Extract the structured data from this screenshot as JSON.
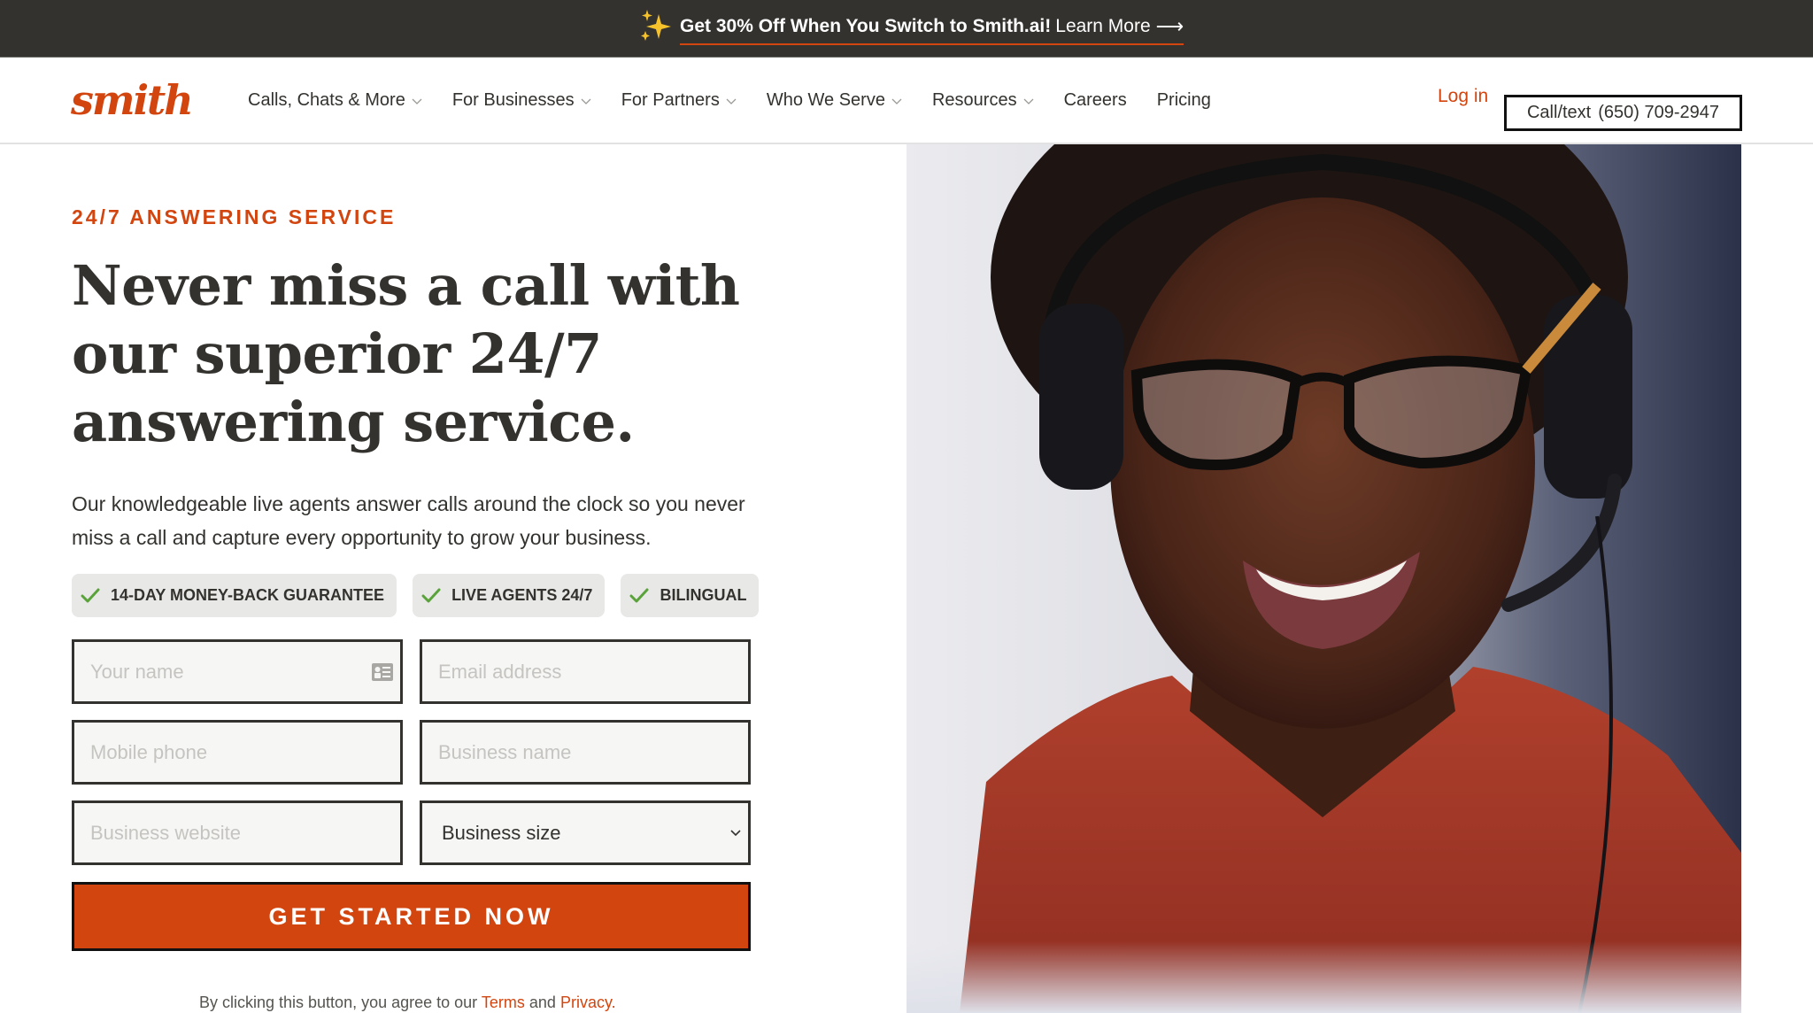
{
  "banner": {
    "icon": "sparkles-icon",
    "headline": "Get 30% Off When You Switch to Smith.ai!",
    "link_label": "Learn More",
    "arrow": "⟶"
  },
  "header": {
    "logo_text": "smith",
    "nav": [
      {
        "label": "Calls, Chats & More",
        "has_dropdown": true
      },
      {
        "label": "For Businesses",
        "has_dropdown": true
      },
      {
        "label": "For Partners",
        "has_dropdown": true
      },
      {
        "label": "Who We Serve",
        "has_dropdown": true
      },
      {
        "label": "Resources",
        "has_dropdown": true
      },
      {
        "label": "Careers",
        "has_dropdown": false
      },
      {
        "label": "Pricing",
        "has_dropdown": false
      }
    ],
    "login_label": "Log in",
    "call_label": "Call/text",
    "call_number": "(650) 709-2947"
  },
  "hero": {
    "eyebrow": "24/7 ANSWERING SERVICE",
    "headline_lines": [
      "Never miss a call with",
      "our superior 24/7",
      "answering service."
    ],
    "lead": "Our knowledgeable live agents answer calls around the clock so you never miss a call and capture every opportunity to grow your business.",
    "badges": [
      {
        "icon": "check-icon",
        "label": "14-DAY MONEY-BACK GUARANTEE"
      },
      {
        "icon": "check-icon",
        "label": "LIVE AGENTS 24/7"
      },
      {
        "icon": "check-icon",
        "label": "BILINGUAL"
      }
    ],
    "image_alt": "Smiling answering-service agent wearing glasses and a headset"
  },
  "form": {
    "name_placeholder": "Your name",
    "email_placeholder": "Email address",
    "phone_placeholder": "Mobile phone",
    "business_name_placeholder": "Business name",
    "website_placeholder": "Business website",
    "size_selected": "Business size",
    "submit_label": "GET STARTED NOW",
    "disclaimer_prefix": "By clicking this button, you agree to our",
    "terms_label": "Terms",
    "and": "and",
    "privacy_label": "Privacy."
  },
  "colors": {
    "brand": "#d3450f",
    "banner_bg": "#33322e",
    "text": "#33322e",
    "badge_bg": "#e8e8e7",
    "check": "#5aa33a",
    "input_bg": "#f6f6f5"
  }
}
